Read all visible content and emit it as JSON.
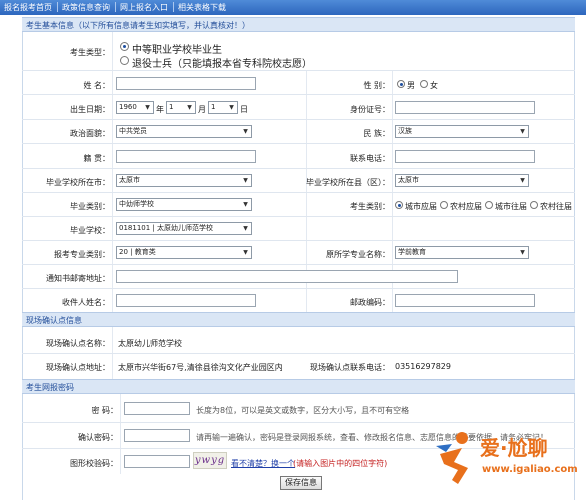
{
  "nav": [
    "报名报考首页",
    "政策信息查询",
    "网上报名入口",
    "相关表格下载"
  ],
  "sections": {
    "basic": "考生基本信息（以下所有信息请考生如实填写，并认真核对！）",
    "confirm": "现场确认点信息",
    "password": "考生网报密码"
  },
  "form": {
    "candidate_type": {
      "label": "考生类型：",
      "option1": "中等职业学校毕业生",
      "option2": "退役士兵（只能填报本省专科院校志愿）",
      "selected": "option1"
    },
    "name_label": "姓 名：",
    "gender": {
      "label": "性 别：",
      "male": "男",
      "female": "女",
      "selected": "male"
    },
    "birth": {
      "label": "出生日期：",
      "year": "1960",
      "year_unit": "年",
      "month": "1",
      "month_unit": "月",
      "day": "1",
      "day_unit": "日"
    },
    "id_label": "身份证号：",
    "politics": {
      "label": "政治面貌：",
      "value": "中共党员"
    },
    "ethnic": {
      "label": "民 族：",
      "value": "汉族"
    },
    "native_label": "籍 贯：",
    "phone_label": "联系电话：",
    "school_city": {
      "label": "毕业学校所在市：",
      "value": "太原市"
    },
    "school_county": {
      "label": "毕业学校所在县（区）：",
      "value": "太原市"
    },
    "grad_type": {
      "label": "毕业类别：",
      "value": "中幼师学校"
    },
    "exam_type": {
      "label": "考生类别：",
      "options": [
        "城市应届",
        "农村应届",
        "城市往届",
        "农村往届"
      ],
      "selected": 0
    },
    "grad_school": {
      "label": "毕业学校：",
      "value": "0181101 | 太原幼儿师范学校"
    },
    "apply_major": {
      "label": "报考专业类别：",
      "value": "20 | 教育类"
    },
    "orig_major": {
      "label": "原所学专业名称：",
      "value": "学前教育"
    },
    "mail_addr_label": "通知书邮寄地址：",
    "recipient_label": "收件人姓名：",
    "zip_label": "邮政编码："
  },
  "confirm": {
    "name_label": "现场确认点名称：",
    "name_value": "太原幼儿师范学校",
    "addr_label": "现场确认点地址：",
    "addr_value": "太原市兴华街67号,清徐县徐沟文化产业园区内",
    "phone_label": "现场确认点联系电话：",
    "phone_value": "03516297829"
  },
  "password": {
    "pwd_label": "密 码：",
    "pwd_hint": "长度为8位，可以是英文或数字，区分大小写，且不可有空格",
    "confirm_label": "确认密码：",
    "confirm_hint": "请再输一遍确认，密码是登录网报系统，查看、修改报名信息、志愿信息的重要依据，请务必牢记！",
    "captcha_label": "图形校验码：",
    "captcha_text": "ywyg",
    "refresh_link": "看不清楚？换一个",
    "captcha_hint": "(请输入图片中的四位字符)"
  },
  "save_button": "保存信息",
  "watermark": {
    "title": "爱·尬聊",
    "url": "www.igaliao.com"
  },
  "colors": {
    "nav_bg": "#3a74cc",
    "section_bg": "#dae6f5",
    "section_text": "#244f9a",
    "hint_red": "#c41e1e",
    "watermark": "#e8701c"
  }
}
